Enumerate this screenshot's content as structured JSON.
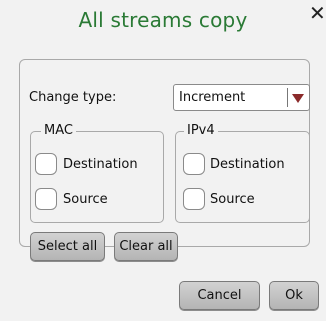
{
  "dialog": {
    "title": "All streams copy"
  },
  "change_type": {
    "label": "Change type:",
    "value": "Increment"
  },
  "mac": {
    "title": "MAC",
    "destination_label": "Destination",
    "source_label": "Source",
    "destination_checked": false,
    "source_checked": false
  },
  "ipv4": {
    "title": "IPv4",
    "destination_label": "Destination",
    "source_label": "Source",
    "destination_checked": false,
    "source_checked": false
  },
  "buttons": {
    "select_all": "Select all",
    "clear_all": "Clear all",
    "cancel": "Cancel",
    "ok": "Ok"
  },
  "icons": {
    "close": "close-icon",
    "dropdown": "triangle-down-icon"
  },
  "colors": {
    "title": "#2a7a35",
    "dropdown_arrow": "#8b2a2a"
  }
}
